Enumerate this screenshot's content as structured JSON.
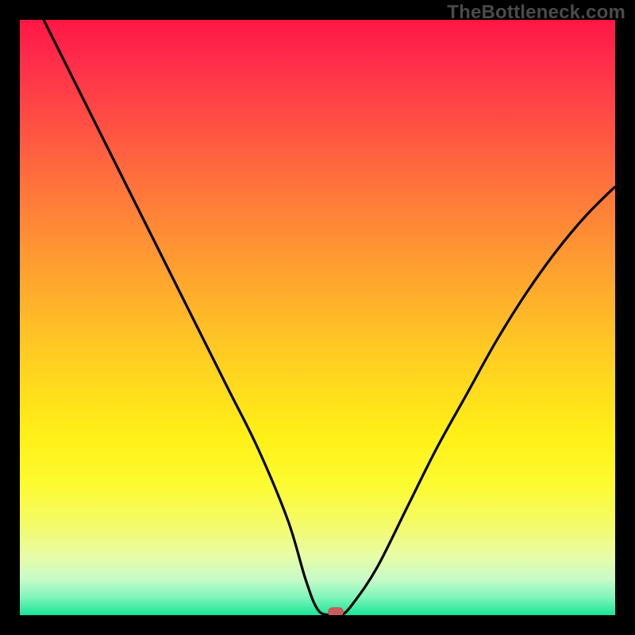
{
  "watermark": "TheBottleneck.com",
  "chart_data": {
    "type": "line",
    "title": "",
    "xlabel": "",
    "ylabel": "",
    "xlim": [
      0,
      100
    ],
    "ylim": [
      0,
      100
    ],
    "series": [
      {
        "name": "bottleneck-curve",
        "x": [
          0,
          5,
          10,
          15,
          20,
          25,
          30,
          35,
          40,
          45,
          48,
          50,
          52,
          54,
          56,
          60,
          65,
          70,
          75,
          80,
          85,
          90,
          95,
          100
        ],
        "values": [
          108,
          98,
          88,
          78,
          68,
          58,
          48,
          38,
          28,
          16,
          6,
          1,
          0,
          0,
          2,
          8,
          18,
          28,
          37,
          46,
          54,
          61,
          67,
          72
        ]
      }
    ],
    "annotations": [
      {
        "name": "optimal-marker",
        "x": 53,
        "y": 0.5
      }
    ],
    "background_gradient": {
      "stops": [
        {
          "pct": 0,
          "color": "#ff1744"
        },
        {
          "pct": 50,
          "color": "#ffc624"
        },
        {
          "pct": 80,
          "color": "#fdfb30"
        },
        {
          "pct": 100,
          "color": "#19e597"
        }
      ],
      "direction": "vertical"
    }
  }
}
